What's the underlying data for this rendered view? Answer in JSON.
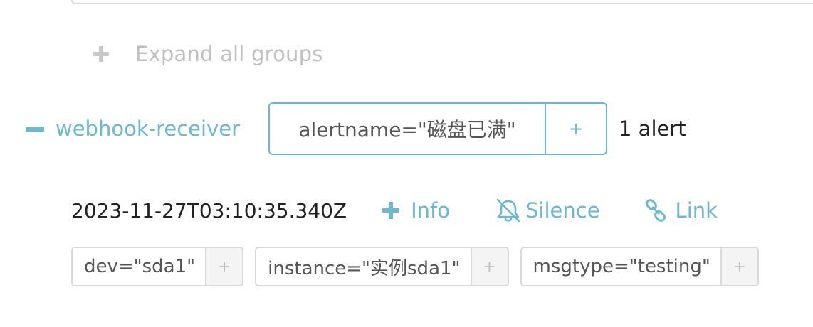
{
  "expand_all": {
    "label": "Expand all groups",
    "icon": "plus-icon"
  },
  "group": {
    "toggle_icon": "minus-icon",
    "receiver": "webhook-receiver",
    "label_filter": "alertname=\"磁盘已满\"",
    "label_filter_add": "+",
    "alert_count": "1 alert"
  },
  "alert": {
    "timestamp": "2023-11-27T03:10:35.340Z",
    "actions": {
      "info": "Info",
      "silence": "Silence",
      "link": "Link"
    },
    "labels": [
      {
        "text": "dev=\"sda1\"",
        "add": "+"
      },
      {
        "text": "instance=\"实例sda1\"",
        "add": "+"
      },
      {
        "text": "msgtype=\"testing\"",
        "add": "+"
      }
    ]
  },
  "colors": {
    "accent": "#6bb8d4",
    "muted": "#c0c0c0",
    "text": "#222222",
    "label_text": "#555555",
    "border": "#d9d9d9"
  }
}
